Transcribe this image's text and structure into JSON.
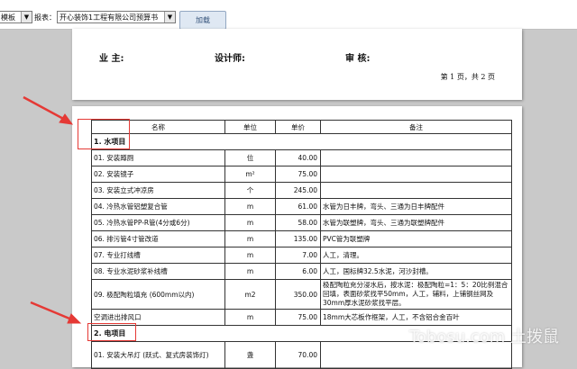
{
  "toolbar": {
    "first_select": "模板",
    "report_label": "报表：",
    "report_select": "开心装饰1工程有限公司预算书",
    "load_button": "加载"
  },
  "page1": {
    "owner_label": "业 主:",
    "designer_label": "设计师:",
    "reviewer_label": "审 核:",
    "page_number": "第 1 页，共 2 页"
  },
  "table": {
    "headers": [
      "名称",
      "单位",
      "单价",
      "备注"
    ],
    "section1": "1. 水项目",
    "rows1": [
      {
        "name": "01. 安装蹲厕",
        "unit": "位",
        "price": "40.00",
        "note": ""
      },
      {
        "name": "02. 安装镜子",
        "unit": "m²",
        "price": "75.00",
        "note": ""
      },
      {
        "name": "03. 安装立式冲凉房",
        "unit": "个",
        "price": "245.00",
        "note": ""
      },
      {
        "name": "04. 冷热水管铝塑复合管",
        "unit": "m",
        "price": "61.00",
        "note": "水管为日丰牌，弯头、三通为日丰牌配件"
      },
      {
        "name": "05. 冷热水管PP-R管(4分或6分)",
        "unit": "m",
        "price": "58.00",
        "note": "水管为联塑牌，弯头、三通为联塑牌配件"
      },
      {
        "name": "06. 排污管4寸管改道",
        "unit": "m",
        "price": "135.00",
        "note": "PVC管为联塑牌"
      },
      {
        "name": "07. 专业打线槽",
        "unit": "m",
        "price": "7.00",
        "note": "人工，清理。"
      },
      {
        "name": "08. 专业水泥砂浆补线槽",
        "unit": "m",
        "price": "6.00",
        "note": "人工，国标牌32.5水泥，河沙封槽。"
      },
      {
        "name": "09. 极配陶粒填充 (600mm以内)",
        "unit": "m2",
        "price": "350.00",
        "note": "极配陶粒充分浸水后，按水泥：极配陶粒=1：5：20比例混合回填，表面砂浆找平50mm，人工，辅料，上铺钢丝网及30mm厚水泥砂浆找平层。"
      },
      {
        "name": "空调进出排风口",
        "unit": "m",
        "price": "75.00",
        "note": "18mm大芯板作框架，人工，不含铝合金百叶"
      }
    ],
    "section2": "2. 电项目",
    "rows2": [
      {
        "name": "01. 安装大吊灯 (跃式、复式房装饰灯)",
        "unit": "盏",
        "price": "70.00",
        "note": ""
      }
    ]
  },
  "watermark": "Tobosu.com 土拨鼠"
}
